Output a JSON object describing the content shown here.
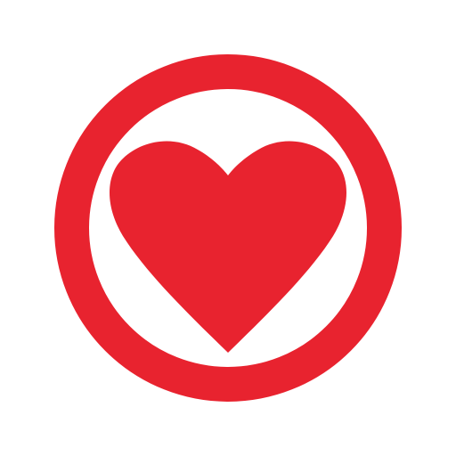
{
  "logo": {
    "icon": "heart-in-circle-icon",
    "colors": {
      "primary": "#E8232F",
      "background": "#FFFFFF"
    }
  }
}
